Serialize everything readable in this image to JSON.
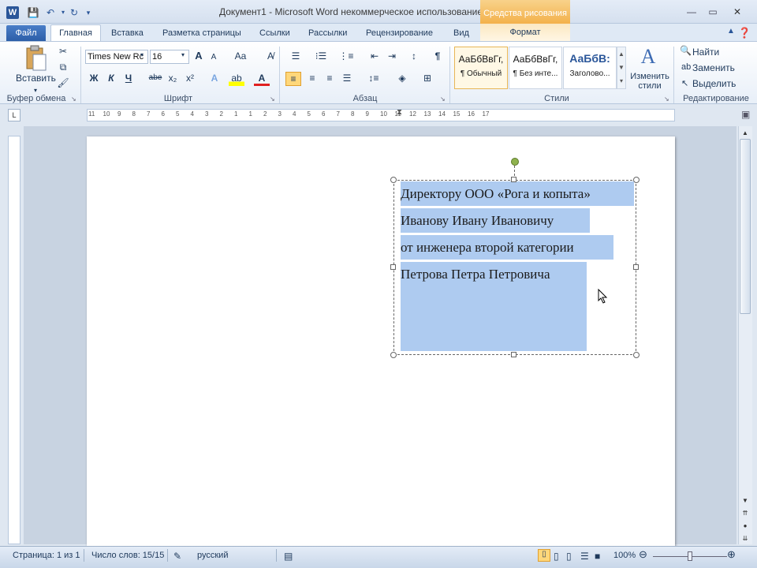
{
  "window": {
    "title": "Документ1  -  Microsoft Word некоммерческое использование",
    "context_tab_group": "Средства рисования"
  },
  "quick_access": {
    "icons": [
      "word-icon",
      "save-icon",
      "undo-icon",
      "redo-icon",
      "customize-icon"
    ]
  },
  "tabs": {
    "file": "Файл",
    "items": [
      "Главная",
      "Вставка",
      "Разметка страницы",
      "Ссылки",
      "Рассылки",
      "Рецензирование",
      "Вид"
    ],
    "format": "Формат"
  },
  "ribbon": {
    "clipboard": {
      "paste": "Вставить",
      "label": "Буфер обмена"
    },
    "font": {
      "name": "Times New Rc",
      "size": "16",
      "label": "Шрифт",
      "bold": "Ж",
      "italic": "К",
      "underline": "Ч",
      "strike": "abe",
      "sub": "x₂",
      "sup": "x²",
      "grow": "A",
      "shrink": "A",
      "case": "Aa"
    },
    "paragraph": {
      "label": "Абзац"
    },
    "styles": {
      "label": "Стили",
      "items": [
        {
          "sample": "АаБбВвГг,",
          "name": "¶ Обычный"
        },
        {
          "sample": "АаБбВвГг,",
          "name": "¶ Без инте..."
        },
        {
          "sample": "АаБбВ:",
          "name": "Заголово..."
        }
      ],
      "change": "Изменить стили"
    },
    "editing": {
      "label": "Редактирование",
      "find": "Найти",
      "replace": "Заменить",
      "select": "Выделить"
    }
  },
  "ruler": {
    "marks": [
      "11",
      "10",
      "9",
      "8",
      "7",
      "6",
      "5",
      "4",
      "3",
      "2",
      "1",
      "1",
      "2",
      "3",
      "4",
      "5",
      "6",
      "7",
      "8",
      "9",
      "10",
      "11",
      "12",
      "13",
      "14",
      "15",
      "16",
      "17"
    ]
  },
  "document": {
    "lines": [
      "Директору ООО «Рога и копыта»",
      "Иванову  Ивану  Ивановичу",
      "от инженера  второй категории",
      "Петрова Петра Петровича"
    ]
  },
  "status": {
    "page": "Страница: 1 из 1",
    "words": "Число слов: 15/15",
    "language": "русский",
    "zoom": "100%",
    "zoom_level": 1.0
  },
  "colors": {
    "selection": "#aecbf0",
    "file_tab": "#2c5ea8",
    "context_tab": "#f3b14b"
  }
}
